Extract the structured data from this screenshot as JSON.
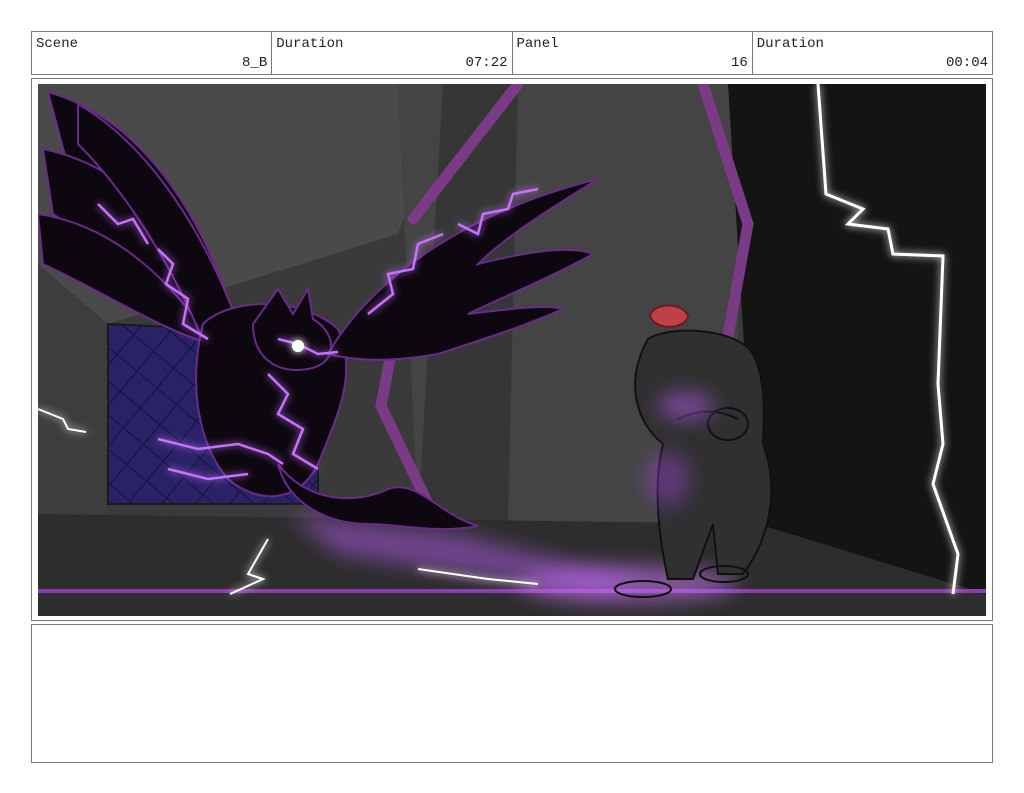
{
  "header": {
    "scene": {
      "label": "Scene",
      "value": "8_B"
    },
    "scene_duration": {
      "label": "Duration",
      "value": "07:22"
    },
    "panel": {
      "label": "Panel",
      "value": "16"
    },
    "panel_duration": {
      "label": "Duration",
      "value": "00:04"
    }
  },
  "notes": {
    "text": ""
  },
  "colors": {
    "background": "#2c2c2c",
    "energy": "#b44bff",
    "pillar": "#7a3a86",
    "hair": "#c0404a",
    "grid": "#2a2266"
  }
}
